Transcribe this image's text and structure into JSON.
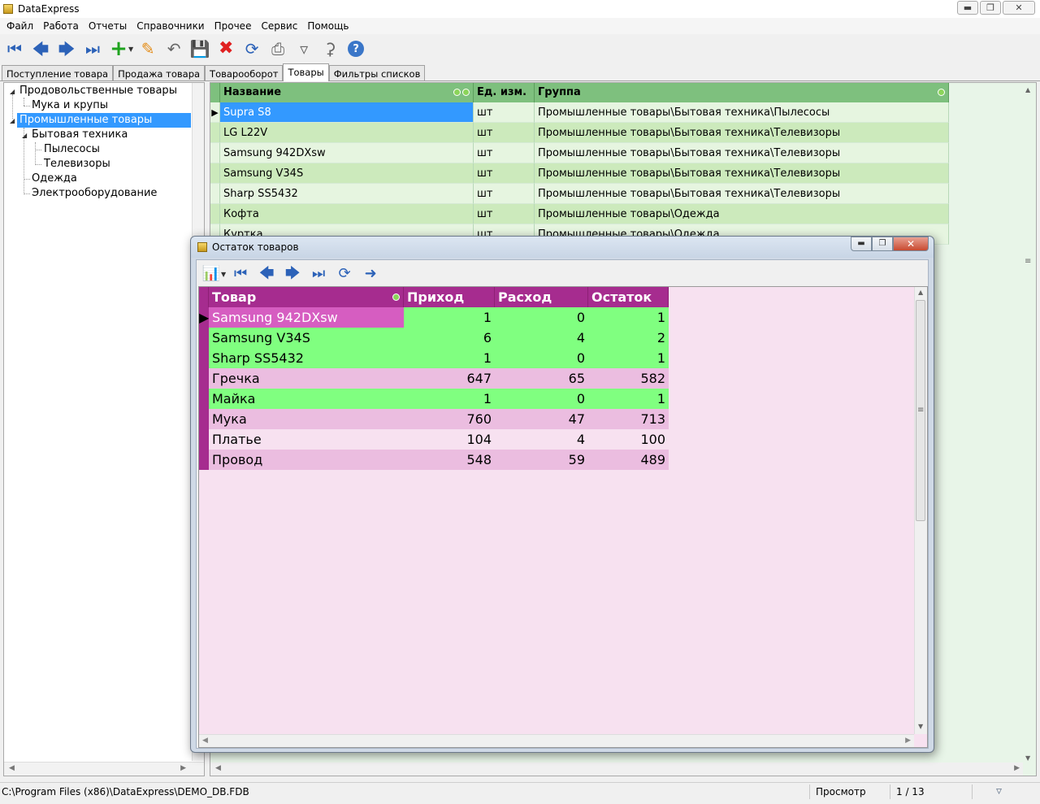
{
  "window": {
    "title": "DataExpress"
  },
  "menu": [
    "Файл",
    "Работа",
    "Отчеты",
    "Справочники",
    "Прочее",
    "Сервис",
    "Помощь"
  ],
  "tabs": [
    "Поступление товара",
    "Продажа товара",
    "Товарооборот",
    "Товары",
    "Фильтры списков"
  ],
  "tree": {
    "items": [
      "Продовольственные товары",
      "Мука и крупы",
      "Промышленные товары",
      "Бытовая техника",
      "Пылесосы",
      "Телевизоры",
      "Одежда",
      "Электрооборудование"
    ],
    "selected": "Промышленные товары"
  },
  "products_grid": {
    "columns": [
      "Название",
      "Ед. изм.",
      "Группа"
    ],
    "rows": [
      [
        "Supra S8",
        "шт",
        "Промышленные товары\\Бытовая техника\\Пылесосы"
      ],
      [
        "LG L22V",
        "шт",
        "Промышленные товары\\Бытовая техника\\Телевизоры"
      ],
      [
        "Samsung 942DXsw",
        "шт",
        "Промышленные товары\\Бытовая техника\\Телевизоры"
      ],
      [
        "Samsung V34S",
        "шт",
        "Промышленные товары\\Бытовая техника\\Телевизоры"
      ],
      [
        "Sharp SS5432",
        "шт",
        "Промышленные товары\\Бытовая техника\\Телевизоры"
      ],
      [
        "Кофта",
        "шт",
        "Промышленные товары\\Одежда"
      ],
      [
        "Куртка",
        "шт",
        "Промышленные товары\\Одежда"
      ]
    ],
    "selected_row": "Supra S8"
  },
  "dialog": {
    "title": "Остаток товаров",
    "columns": [
      "Товар",
      "Приход",
      "Расход",
      "Остаток"
    ],
    "rows": [
      {
        "name": "Samsung 942DXsw",
        "in": "1",
        "out": "0",
        "rest": "1",
        "style": "green"
      },
      {
        "name": "Samsung V34S",
        "in": "6",
        "out": "4",
        "rest": "2",
        "style": "green"
      },
      {
        "name": "Sharp SS5432",
        "in": "1",
        "out": "0",
        "rest": "1",
        "style": "green"
      },
      {
        "name": "Гречка",
        "in": "647",
        "out": "65",
        "rest": "582",
        "style": "pink"
      },
      {
        "name": "Майка",
        "in": "1",
        "out": "0",
        "rest": "1",
        "style": "green"
      },
      {
        "name": "Мука",
        "in": "760",
        "out": "47",
        "rest": "713",
        "style": "pink"
      },
      {
        "name": "Платье",
        "in": "104",
        "out": "4",
        "rest": "100",
        "style": "light"
      },
      {
        "name": "Провод",
        "in": "548",
        "out": "59",
        "rest": "489",
        "style": "pink"
      }
    ],
    "selected_row": "Samsung 942DXsw"
  },
  "status": {
    "path": "C:\\Program Files (x86)\\DataExpress\\DEMO_DB.FDB",
    "mode": "Просмотр",
    "record": "1 / 13"
  },
  "colors": {
    "grid_header_green": "#7ec07e",
    "dialog_header_purple": "#a62c8f",
    "row_green": "#80ff80",
    "row_pink": "#ebbde0",
    "selection_blue": "#3399ff"
  }
}
